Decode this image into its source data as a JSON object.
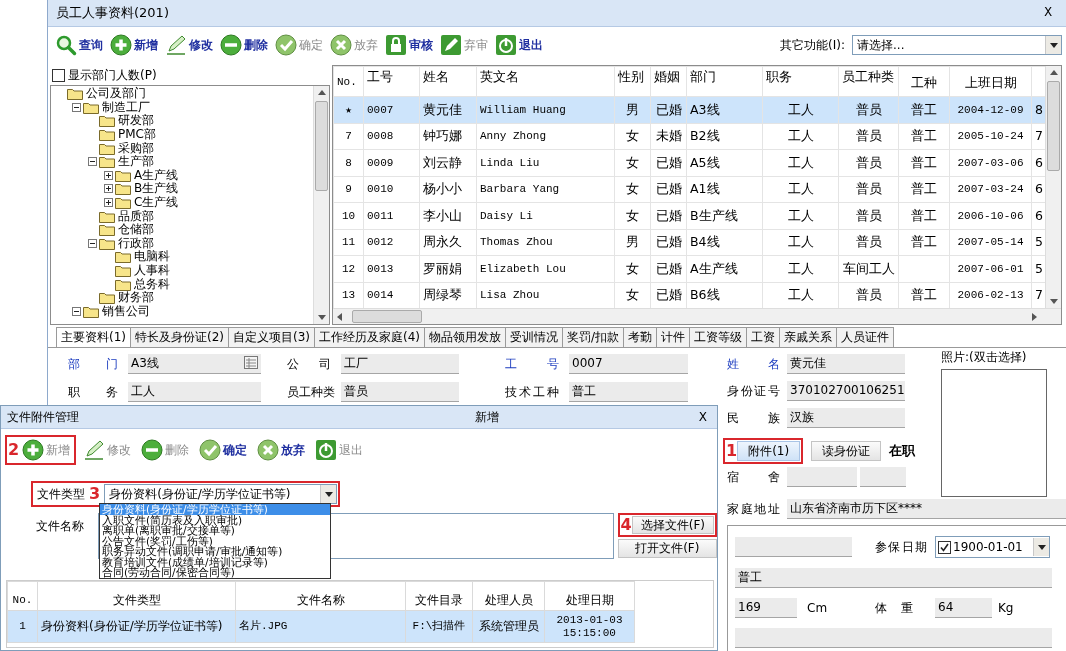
{
  "window": {
    "title": "员工人事资料(201)",
    "close": "X"
  },
  "toolbar": [
    {
      "label": "查询",
      "kind": "search",
      "disabled": false
    },
    {
      "label": "新增",
      "kind": "add",
      "disabled": false
    },
    {
      "label": "修改",
      "kind": "edit",
      "disabled": false
    },
    {
      "label": "删除",
      "kind": "delete",
      "disabled": false
    },
    {
      "label": "确定",
      "kind": "confirm",
      "disabled": true
    },
    {
      "label": "放弃",
      "kind": "cancel",
      "disabled": true
    },
    {
      "label": "审核",
      "kind": "approve",
      "disabled": false
    },
    {
      "label": "弃审",
      "kind": "unapprove",
      "disabled": true
    },
    {
      "label": "退出",
      "kind": "exit",
      "disabled": false
    }
  ],
  "other_functions": {
    "label": "其它功能(I):",
    "value": "请选择..."
  },
  "dept_panel": {
    "show_count": {
      "label": "显示部门人数(P)",
      "checked": false
    },
    "tree": [
      {
        "label": "公司及部门",
        "children": [
          {
            "label": "制造工厂",
            "expanded": true,
            "children": [
              {
                "label": "研发部"
              },
              {
                "label": "PMC部"
              },
              {
                "label": "采购部"
              },
              {
                "label": "生产部",
                "expanded": true,
                "children": [
                  {
                    "label": "A生产线",
                    "expanded": false
                  },
                  {
                    "label": "B生产线",
                    "expanded": false
                  },
                  {
                    "label": "C生产线",
                    "expanded": false
                  }
                ]
              },
              {
                "label": "品质部"
              },
              {
                "label": "仓储部"
              },
              {
                "label": "行政部",
                "expanded": true,
                "children": [
                  {
                    "label": "电脑科"
                  },
                  {
                    "label": "人事科"
                  },
                  {
                    "label": "总务科"
                  }
                ]
              },
              {
                "label": "财务部"
              }
            ]
          },
          {
            "label": "销售公司",
            "expanded": true
          }
        ]
      }
    ]
  },
  "employees": {
    "columns": [
      "No.",
      "工号",
      "姓名",
      "英文名",
      "性别",
      "婚姻",
      "部门",
      "职务",
      "员工种类",
      "工种",
      "上班日期"
    ],
    "rows": [
      {
        "selected": true,
        "cells": [
          "★",
          "0007",
          "黄元佳",
          "William Huang",
          "男",
          "已婚",
          "A3线",
          "工人",
          "普员",
          "普工",
          "2004-12-09",
          "8"
        ]
      },
      {
        "selected": false,
        "cells": [
          "7",
          "0008",
          "钟巧娜",
          "Anny Zhong",
          "女",
          "未婚",
          "B2线",
          "工人",
          "普员",
          "普工",
          "2005-10-24",
          "7"
        ]
      },
      {
        "selected": false,
        "cells": [
          "8",
          "0009",
          "刘云静",
          "Linda Liu",
          "女",
          "已婚",
          "A5线",
          "工人",
          "普员",
          "普工",
          "2007-03-06",
          "6"
        ]
      },
      {
        "selected": false,
        "cells": [
          "9",
          "0010",
          "杨小小",
          "Barbara Yang",
          "女",
          "已婚",
          "A1线",
          "工人",
          "普员",
          "普工",
          "2007-03-24",
          "6"
        ]
      },
      {
        "selected": false,
        "cells": [
          "10",
          "0011",
          "李小山",
          "Daisy Li",
          "女",
          "已婚",
          "B生产线",
          "工人",
          "普员",
          "普工",
          "2006-10-06",
          "6"
        ]
      },
      {
        "selected": false,
        "cells": [
          "11",
          "0012",
          "周永久",
          "Thomas Zhou",
          "男",
          "已婚",
          "B4线",
          "工人",
          "普员",
          "普工",
          "2007-05-14",
          "5"
        ]
      },
      {
        "selected": false,
        "cells": [
          "12",
          "0013",
          "罗丽娟",
          "Elizabeth Lou",
          "女",
          "已婚",
          "A生产线",
          "工人",
          "车间工人",
          null,
          "2007-06-01",
          "5"
        ]
      },
      {
        "selected": false,
        "cells": [
          "13",
          "0014",
          "周绿琴",
          "Lisa Zhou",
          "女",
          "已婚",
          "B6线",
          "工人",
          "普员",
          "普工",
          "2006-02-13",
          "7"
        ]
      }
    ]
  },
  "tabs": [
    {
      "label": "主要资料(1)",
      "selected": true
    },
    {
      "label": "特长及身份证(2)",
      "selected": false
    },
    {
      "label": "自定义项目(3)",
      "selected": false
    },
    {
      "label": "工作经历及家庭(4)",
      "selected": false
    },
    {
      "label": "物品领用发放",
      "selected": false
    },
    {
      "label": "受训情况",
      "selected": false
    },
    {
      "label": "奖罚/扣款",
      "selected": false
    },
    {
      "label": "考勤",
      "selected": false
    },
    {
      "label": "计件",
      "selected": false
    },
    {
      "label": "工资等级",
      "selected": false
    },
    {
      "label": "工资",
      "selected": false
    },
    {
      "label": "亲戚关系",
      "selected": false
    },
    {
      "label": "人员证件",
      "selected": false
    }
  ],
  "form": {
    "left": [
      {
        "label": "部门",
        "value": "A3线",
        "required": true,
        "picker": true
      },
      {
        "label": "公司",
        "value": "工厂",
        "required": false
      },
      {
        "label": "工号",
        "value": "0007",
        "required": true
      },
      {
        "label": "职务",
        "value": "工人",
        "required": false
      },
      {
        "label": "员工种类",
        "value": "普员",
        "required": false
      },
      {
        "label": "技术工种",
        "value": "普工",
        "required": false
      }
    ],
    "right": [
      {
        "label": "姓名",
        "value": "黄元佳",
        "required": true
      },
      {
        "label": "身份证号",
        "value": "370102700106251",
        "required": false
      },
      {
        "label": "民族",
        "value": "汉族",
        "required": false
      }
    ],
    "photo_label": "照片:(双击选择)",
    "attach_button": {
      "label": "附件(1)",
      "callout": "1"
    },
    "read_id_button": {
      "label": "读身份证"
    },
    "status": "在职",
    "dorm_label": "宿舍",
    "address": {
      "label": "家庭地址",
      "value": "山东省济南市历下区****"
    },
    "panel": {
      "insurance": {
        "label": "参保日期",
        "checked": true,
        "value": "1900-01-01"
      },
      "job_field": "普工",
      "height": {
        "value": "169",
        "unit": "Cm"
      },
      "weight": {
        "label": "体重",
        "value": "64",
        "unit": "Kg"
      }
    }
  },
  "dialog": {
    "title": "文件附件管理",
    "mode": "新增",
    "close": "X",
    "toolbar": [
      {
        "label": "新增",
        "kind": "add",
        "disabled": true,
        "callout": "2"
      },
      {
        "label": "修改",
        "kind": "edit",
        "disabled": true
      },
      {
        "label": "删除",
        "kind": "delete",
        "disabled": true
      },
      {
        "label": "确定",
        "kind": "confirm",
        "disabled": false
      },
      {
        "label": "放弃",
        "kind": "cancel",
        "disabled": false
      },
      {
        "label": "退出",
        "kind": "exit",
        "disabled": true
      }
    ],
    "file_type": {
      "label": "文件类型",
      "callout": "3",
      "value": "身份资料(身份证/学历学位证书等)",
      "options": [
        {
          "label": "身份资料(身份证/学历学位证书等)",
          "selected": true
        },
        {
          "label": "入职文件(简历表及入职审批)",
          "selected": false
        },
        {
          "label": "离职单(离职审批/交接单等)",
          "selected": false
        },
        {
          "label": "公告文件(奖罚/工伤等)",
          "selected": false
        },
        {
          "label": "职务异动文件(调职申请/审批/通知等)",
          "selected": false
        },
        {
          "label": "教育培训文件(成绩单/培训记录等)",
          "selected": false
        },
        {
          "label": "合同(劳动合同/保密合同等)",
          "selected": false
        }
      ]
    },
    "file_name": {
      "label": "文件名称"
    },
    "buttons": [
      {
        "label": "选择文件(F)",
        "callout": "4"
      },
      {
        "label": "打开文件(F)"
      }
    ],
    "table": {
      "columns": [
        "No.",
        "文件类型",
        "文件名称",
        "文件目录",
        "处理人员",
        "处理日期"
      ],
      "rows": [
        {
          "selected": true,
          "cells": [
            "1",
            "身份资料(身份证/学历学位证书等)",
            "名片.JPG",
            "F:\\扫描件",
            "系统管理员",
            "2013-01-03 15:15:00"
          ]
        }
      ]
    }
  }
}
